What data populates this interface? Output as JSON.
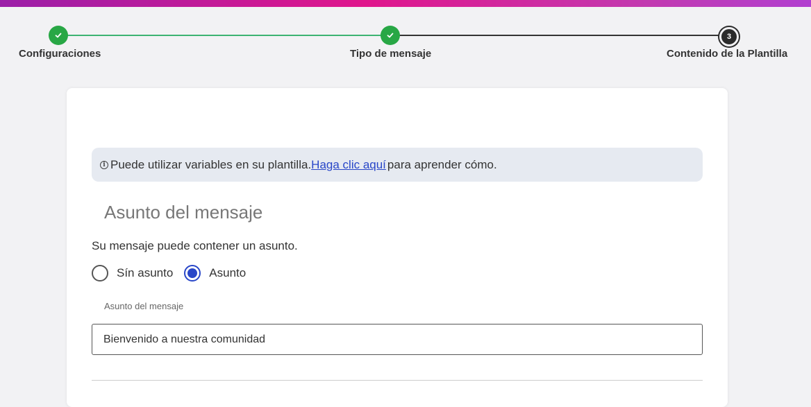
{
  "stepper": {
    "steps": [
      {
        "label": "Configuraciones",
        "state": "done"
      },
      {
        "label": "Tipo de mensaje",
        "state": "done"
      },
      {
        "label": "Contenido de la Plantilla",
        "state": "current",
        "number": "3"
      }
    ],
    "colors": {
      "done": "#28a745",
      "current": "#2b2b2b"
    }
  },
  "info_banner": {
    "text_before": "Puede utilizar variables en su plantilla.",
    "link_text": " Haga clic aquí ",
    "text_after": "para aprender cómo.",
    "icon": "info-icon"
  },
  "subject_section": {
    "title": "Asunto del mensaje",
    "description": "Su mensaje puede contener un asunto.",
    "options": [
      {
        "label": "Sín asunto",
        "selected": false
      },
      {
        "label": "Asunto",
        "selected": true
      }
    ],
    "field_label": "Asunto del mensaje",
    "field_value": "Bienvenido a nuestra comunidad"
  },
  "accent_color": "#2846c8"
}
